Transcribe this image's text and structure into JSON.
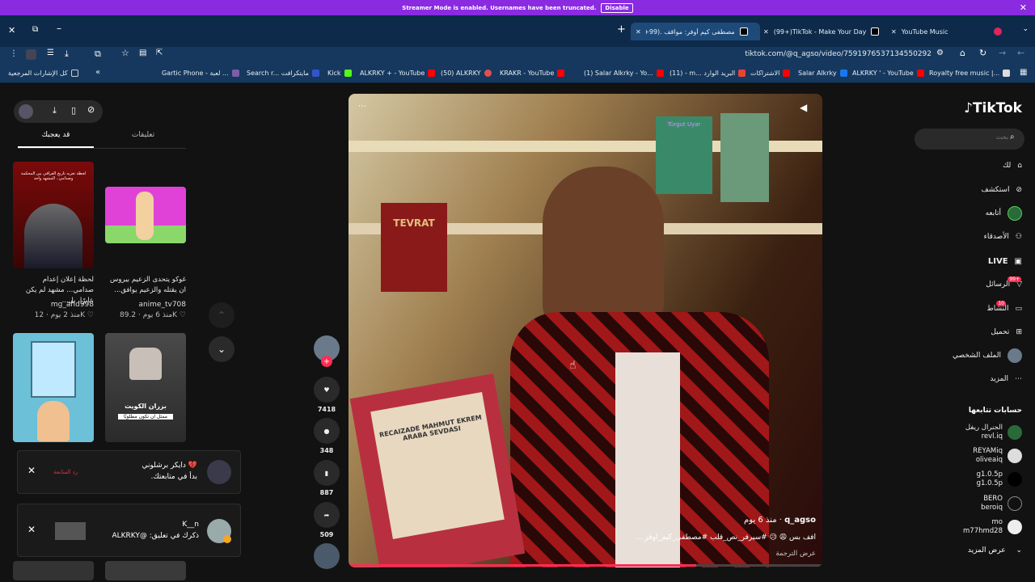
{
  "banner": {
    "text": "Streamer Mode is enabled. Usernames have been truncated.",
    "disable": "Disable"
  },
  "tabs": [
    {
      "title": "مصطفى كيم أوفر: مواقف .(99+)"
    },
    {
      "title": "(99+)TikTok - Make Your Day"
    },
    {
      "title": "YouTube Music"
    }
  ],
  "address": {
    "url": "tiktok.com/@q_agso/video/7591976537134550292"
  },
  "bookmarks": [
    {
      "label": "كل الإشارات المرجعية"
    },
    {
      "label": "Gartic Phone - لعبة ..."
    },
    {
      "label": "Search r... مايتكرافت"
    },
    {
      "label": "Kick"
    },
    {
      "label": "ALKRKY + - YouTube"
    },
    {
      "label": "(50) ALKRKY"
    },
    {
      "label": "KRAKR - YouTube"
    },
    {
      "label": "(1) Salar Alkrky - Yo..."
    },
    {
      "label": "(11) - m... البريد الوارد"
    },
    {
      "label": "الاشتراكات"
    },
    {
      "label": "Salar Alkrky"
    },
    {
      "label": "ALKRKY ' - YouTube"
    },
    {
      "label": "Royalty free music |..."
    }
  ],
  "left_panel": {
    "tab_liked": "قد يعجبك",
    "tab_comments": "تعليقات",
    "videos": [
      {
        "caption": "لحظة إعلان إعدام صدامي... مشهد لم يكن عابرًا، بل...",
        "user": "mg_ahd998",
        "likes": "12K",
        "age": "منذ 2 يوم"
      },
      {
        "caption": "غوكو يتحدى الزعيم بيروس ان يقتله والزعيم يوافق...",
        "user": "anime_tv708",
        "likes": "89.2K",
        "age": "منذ 6 يوم"
      },
      {
        "caption": "",
        "user": "",
        "likes": "",
        "age": ""
      },
      {
        "caption": "",
        "user": "",
        "likes": "",
        "age": "",
        "overlay_title": "بزران الكويت",
        "overlay_sub": "ممثل ان تكون مطلوبًا"
      }
    ],
    "thumb1_text": "لحظة تعزيه تاريخ العراقي بين المحكمة وصدامي.. المشهد واحد"
  },
  "notifications": [
    {
      "name": "دايكر برشلوني 💔",
      "text": "بدأ في متابعتك.",
      "action": "رد المتابعة"
    },
    {
      "name": "K__n",
      "text": "ذكرك في تعليق: @ALKRKY"
    }
  ],
  "video": {
    "username": "q_agso",
    "age": "منذ 6 يوم",
    "caption": "افف بس 😩 😥 #سيرفر_نص_قلب #مصطفى_كيم_اوفر ...",
    "translate": "عرض الترجمة",
    "book_spine": "TEVRAT",
    "book_top": "Türgut Uyar",
    "book_title": "RECAIZADE MAHMUT EKREM ARABA SEVDASI"
  },
  "actions": {
    "likes": "7418",
    "comments": "348",
    "saves": "887",
    "shares": "509"
  },
  "right_nav": {
    "logo": "TikTok",
    "search_placeholder": "بحث",
    "items": [
      {
        "label": "لك"
      },
      {
        "label": "استكشف"
      },
      {
        "label": "أتابعه"
      },
      {
        "label": "الأصدقاء"
      },
      {
        "label": "LIVE"
      },
      {
        "label": "الرسائل",
        "badge": "99+"
      },
      {
        "label": "النشاط",
        "badge": "10"
      },
      {
        "label": "تحميل"
      },
      {
        "label": "الملف الشخصي"
      },
      {
        "label": "المزيد"
      }
    ],
    "following_title": "حسابات تتابعها",
    "following": [
      {
        "name": "الجنرال ريفل",
        "handle": "revl.iq"
      },
      {
        "name": "REYAMiq",
        "handle": "oliveaiq"
      },
      {
        "name": "g1.0.5p",
        "handle": "g1.0.5p"
      },
      {
        "name": "BERO",
        "handle": "beroiq"
      },
      {
        "name": "mo",
        "handle": "m77hmd28"
      }
    ],
    "see_more": "عرض المزيد"
  }
}
